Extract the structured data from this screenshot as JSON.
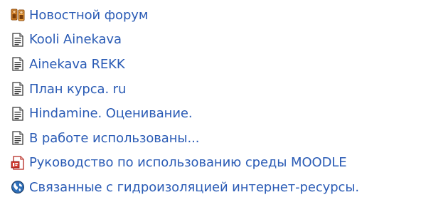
{
  "resources": {
    "items": [
      {
        "icon": "forum-icon",
        "label": "Новостной форум"
      },
      {
        "icon": "document-icon",
        "label": "Kooli Ainekava"
      },
      {
        "icon": "document-icon",
        "label": "Ainekava REKK"
      },
      {
        "icon": "document-icon",
        "label": "План курса. ru"
      },
      {
        "icon": "document-icon",
        "label": "Hindamine. Оценивание."
      },
      {
        "icon": "document-icon",
        "label": "В работе использованы..."
      },
      {
        "icon": "pdf-document-icon",
        "label": "Руководство по использованию среды MOODLE"
      },
      {
        "icon": "web-link-globe-icon",
        "label": "Связанные с гидроизоляцией интернет-ресурсы."
      }
    ]
  },
  "colors": {
    "link": "#2a5bb5"
  }
}
